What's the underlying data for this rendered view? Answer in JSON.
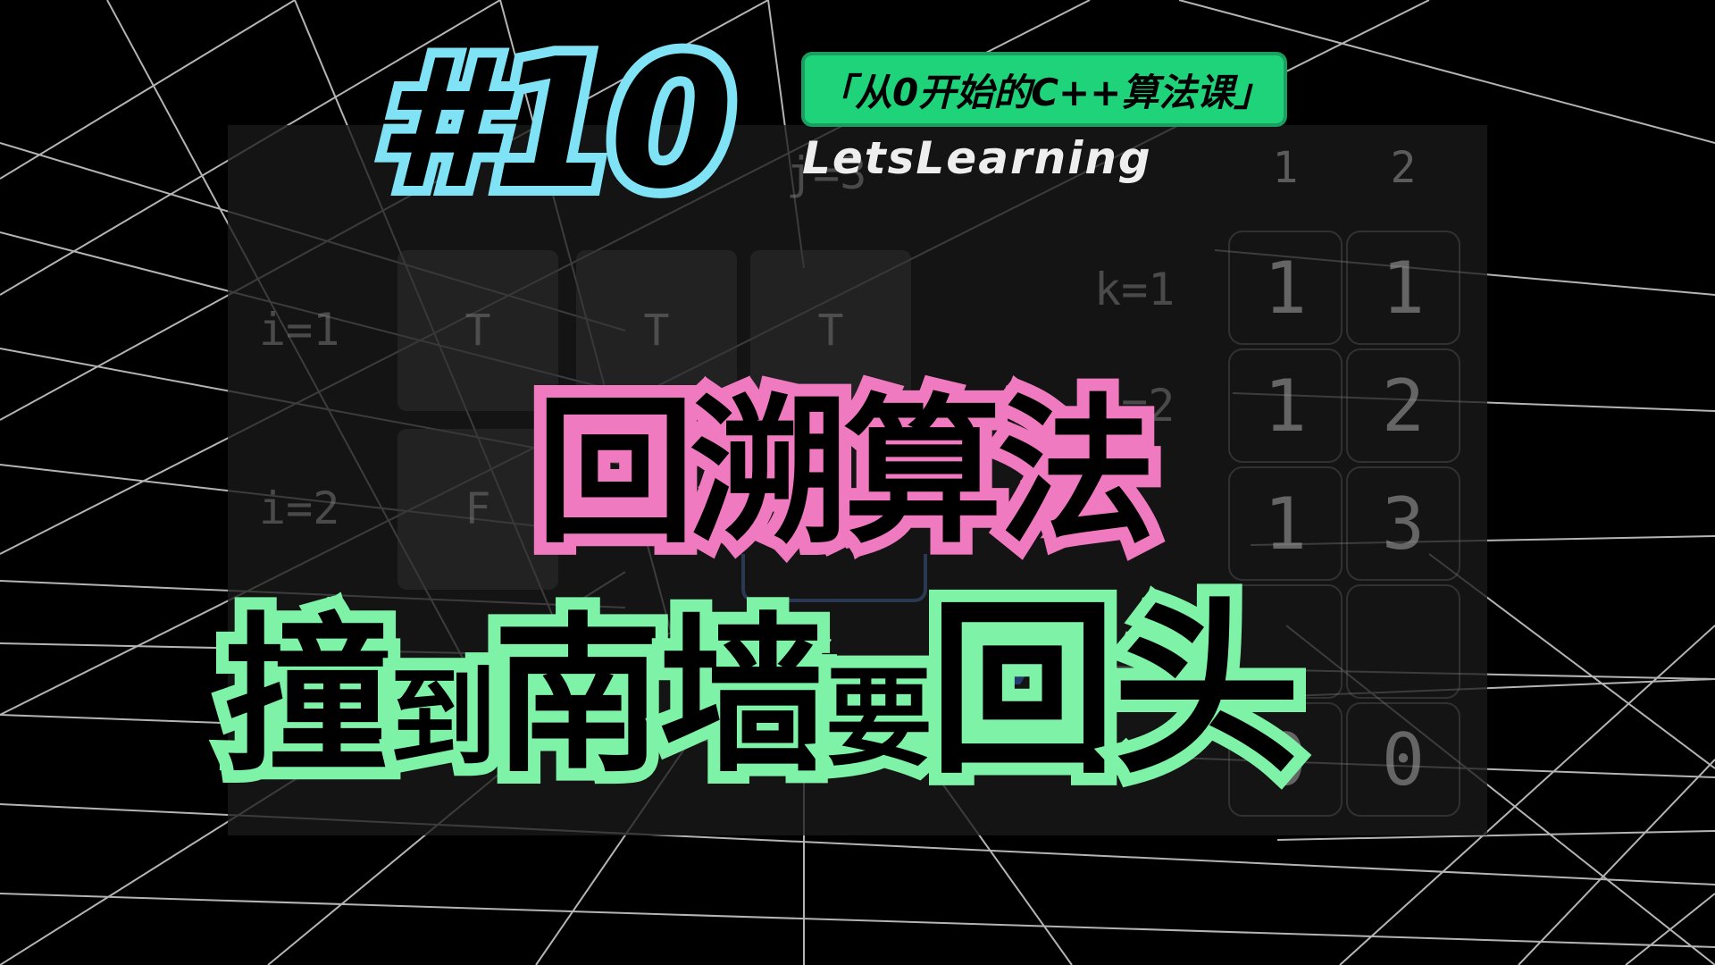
{
  "colors": {
    "background": "#000000",
    "episode_outline": "#7fe3f5",
    "badge_fill": "#1fd37b",
    "title_line1_outline": "#f07ac0",
    "title_line2_outline": "#7ef2a6"
  },
  "episode_number": "#10",
  "series_badge": "「从0开始的C++算法课」",
  "brand": "LetsLearning",
  "title": {
    "line1": "回溯算法",
    "line2": [
      "撞",
      "到",
      "南",
      "墙",
      "要",
      "回",
      "头"
    ]
  },
  "background_scene": {
    "j_label": "j=3",
    "row_labels": [
      "i=1",
      "i=2"
    ],
    "grid_cells": [
      "T",
      "T",
      "T",
      "F"
    ],
    "k_labels": [
      "k=1",
      "k=2"
    ],
    "matrix_headers": [
      "1",
      "2"
    ],
    "matrix_rows": [
      [
        "1",
        "1"
      ],
      [
        "1",
        "2"
      ],
      [
        "1",
        "3"
      ],
      [
        "",
        ""
      ],
      [
        "0",
        "0"
      ]
    ]
  },
  "icons": [
    "chevron-right-icon"
  ]
}
